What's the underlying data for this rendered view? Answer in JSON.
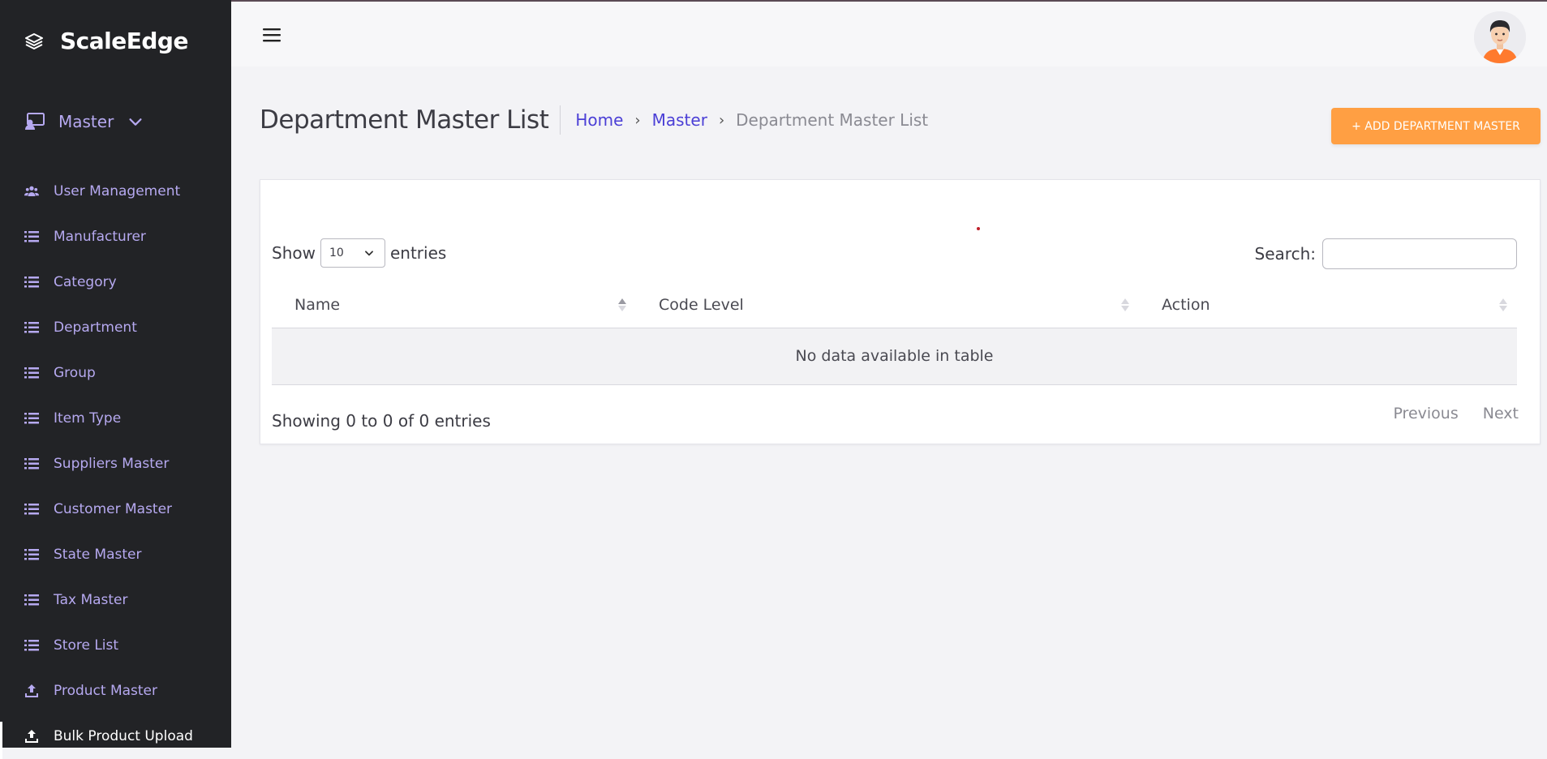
{
  "brand": {
    "name": "ScaleEdge"
  },
  "sidebar": {
    "master_label": "Master",
    "items": [
      {
        "label": "User Management",
        "icon": "users-icon"
      },
      {
        "label": "Manufacturer",
        "icon": "list-icon"
      },
      {
        "label": "Category",
        "icon": "list-icon"
      },
      {
        "label": "Department",
        "icon": "list-icon"
      },
      {
        "label": "Group",
        "icon": "list-icon"
      },
      {
        "label": "Item Type",
        "icon": "list-icon"
      },
      {
        "label": "Suppliers Master",
        "icon": "list-icon"
      },
      {
        "label": "Customer Master",
        "icon": "list-icon"
      },
      {
        "label": "State Master",
        "icon": "list-icon"
      },
      {
        "label": "Tax Master",
        "icon": "list-icon"
      },
      {
        "label": "Store List",
        "icon": "list-icon"
      },
      {
        "label": "Product Master",
        "icon": "upload-icon"
      },
      {
        "label": "Bulk Product Upload",
        "icon": "upload-icon"
      }
    ]
  },
  "header": {
    "title": "Department Master List",
    "breadcrumb": [
      "Home",
      "Master",
      "Department Master List"
    ],
    "add_button": "+ ADD DEPARTMENT MASTER"
  },
  "table": {
    "show_label": "Show",
    "entries_label": "entries",
    "page_length": "10",
    "search_label": "Search:",
    "search_value": "",
    "columns": [
      "Name",
      "Code Level",
      "Action"
    ],
    "empty_message": "No data available in table",
    "info": "Showing 0 to 0 of 0 entries",
    "previous": "Previous",
    "next": "Next"
  },
  "colors": {
    "sidebar_bg": "#222326",
    "sidebar_text": "#b6a9f0",
    "accent": "#ff9f43",
    "link": "#4b3fd6"
  }
}
